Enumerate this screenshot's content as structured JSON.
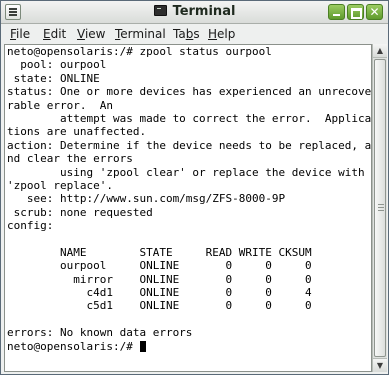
{
  "window": {
    "title": "Terminal",
    "icons": {
      "window_menu": "window-menu-icon",
      "app": "terminal-icon",
      "minimize": "minimize-icon",
      "maximize": "maximize-icon",
      "close": "close-icon"
    },
    "close_glyph": "✕"
  },
  "menubar": {
    "items": [
      {
        "mnemonic": "F",
        "rest": "ile"
      },
      {
        "mnemonic": "E",
        "rest": "dit"
      },
      {
        "mnemonic": "V",
        "rest": "iew"
      },
      {
        "mnemonic": "T",
        "rest": "erminal"
      },
      {
        "pre": "Ta",
        "mnemonic": "b",
        "rest": "s"
      },
      {
        "mnemonic": "H",
        "rest": "elp"
      }
    ]
  },
  "terminal": {
    "lines": [
      "neto@opensolaris:/# zpool status ourpool",
      "  pool: ourpool",
      " state: ONLINE",
      "status: One or more devices has experienced an unrecove",
      "rable error.  An",
      "        attempt was made to correct the error.  Applica",
      "tions are unaffected.",
      "action: Determine if the device needs to be replaced, a",
      "nd clear the errors",
      "        using 'zpool clear' or replace the device with",
      "'zpool replace'.",
      "   see: http://www.sun.com/msg/ZFS-8000-9P",
      " scrub: none requested",
      "config:",
      "",
      "        NAME        STATE     READ WRITE CKSUM",
      "        ourpool     ONLINE       0     0     0",
      "          mirror    ONLINE       0     0     0",
      "            c4d1    ONLINE       0     0     4",
      "            c5d1    ONLINE       0     0     0",
      "",
      "errors: No known data errors"
    ],
    "prompt": "neto@opensolaris:/# "
  },
  "scrollbar": {
    "up_glyph": "▲",
    "down_glyph": "▼"
  },
  "colors": {
    "accent": "#6ea83a",
    "terminal_bg": "#ffffff",
    "terminal_fg": "#000000"
  }
}
